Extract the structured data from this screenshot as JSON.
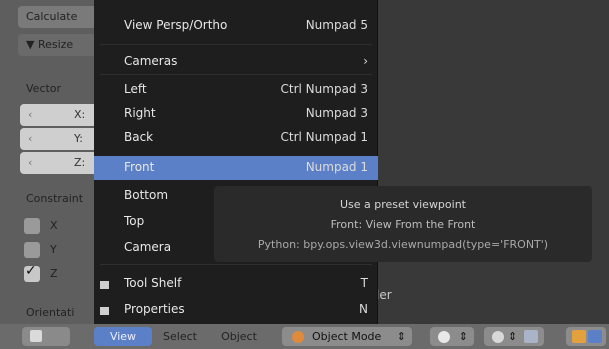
{
  "left_panel": {
    "operator_title": "Calculate",
    "section": "▼ Resize",
    "vector_label": "Vector",
    "vector_fields": [
      {
        "label": "X:"
      },
      {
        "label": "Y:"
      },
      {
        "label": "Z:"
      }
    ],
    "constraint_label": "Constraint",
    "constraint_axes": [
      {
        "label": "X",
        "checked": false
      },
      {
        "label": "Y",
        "checked": false
      },
      {
        "label": "Z",
        "checked": true
      }
    ],
    "orientation_label": "Orientati"
  },
  "view_menu": {
    "items": [
      {
        "label": "View Persp/Ortho",
        "shortcut": "Numpad 5"
      },
      {
        "label": "Cameras",
        "shortcut": "›"
      },
      {
        "label": "Left",
        "shortcut": "Ctrl Numpad 3"
      },
      {
        "label": "Right",
        "shortcut": "Numpad 3"
      },
      {
        "label": "Back",
        "shortcut": "Ctrl Numpad 1"
      },
      {
        "label": "Front",
        "shortcut": "Numpad 1",
        "active": true
      },
      {
        "label": "Bottom",
        "shortcut": ""
      },
      {
        "label": "Top",
        "shortcut": ""
      },
      {
        "label": "Camera",
        "shortcut": ""
      },
      {
        "label": "Tool Shelf",
        "shortcut": "T",
        "checkbox": true
      },
      {
        "label": "Properties",
        "shortcut": "N",
        "checkbox": true
      }
    ]
  },
  "tooltip": {
    "title": "Use a preset viewpoint",
    "description": "Front: View From the Front",
    "python": "Python: bpy.ops.view3d.viewnumpad(type='FRONT')"
  },
  "viewport": {
    "behind_text": "ler"
  },
  "header": {
    "view": "View",
    "select": "Select",
    "object": "Object",
    "mode": "Object Mode",
    "mode_arrow": "⇕",
    "shade_arrow": "⇕",
    "pivot_arrow": "⇕"
  },
  "colors": {
    "accent": "#5b80c8",
    "menu_bg": "#1e1e1e",
    "panel_bg": "#5e5e5e",
    "header_bg": "#6b6b6b"
  }
}
